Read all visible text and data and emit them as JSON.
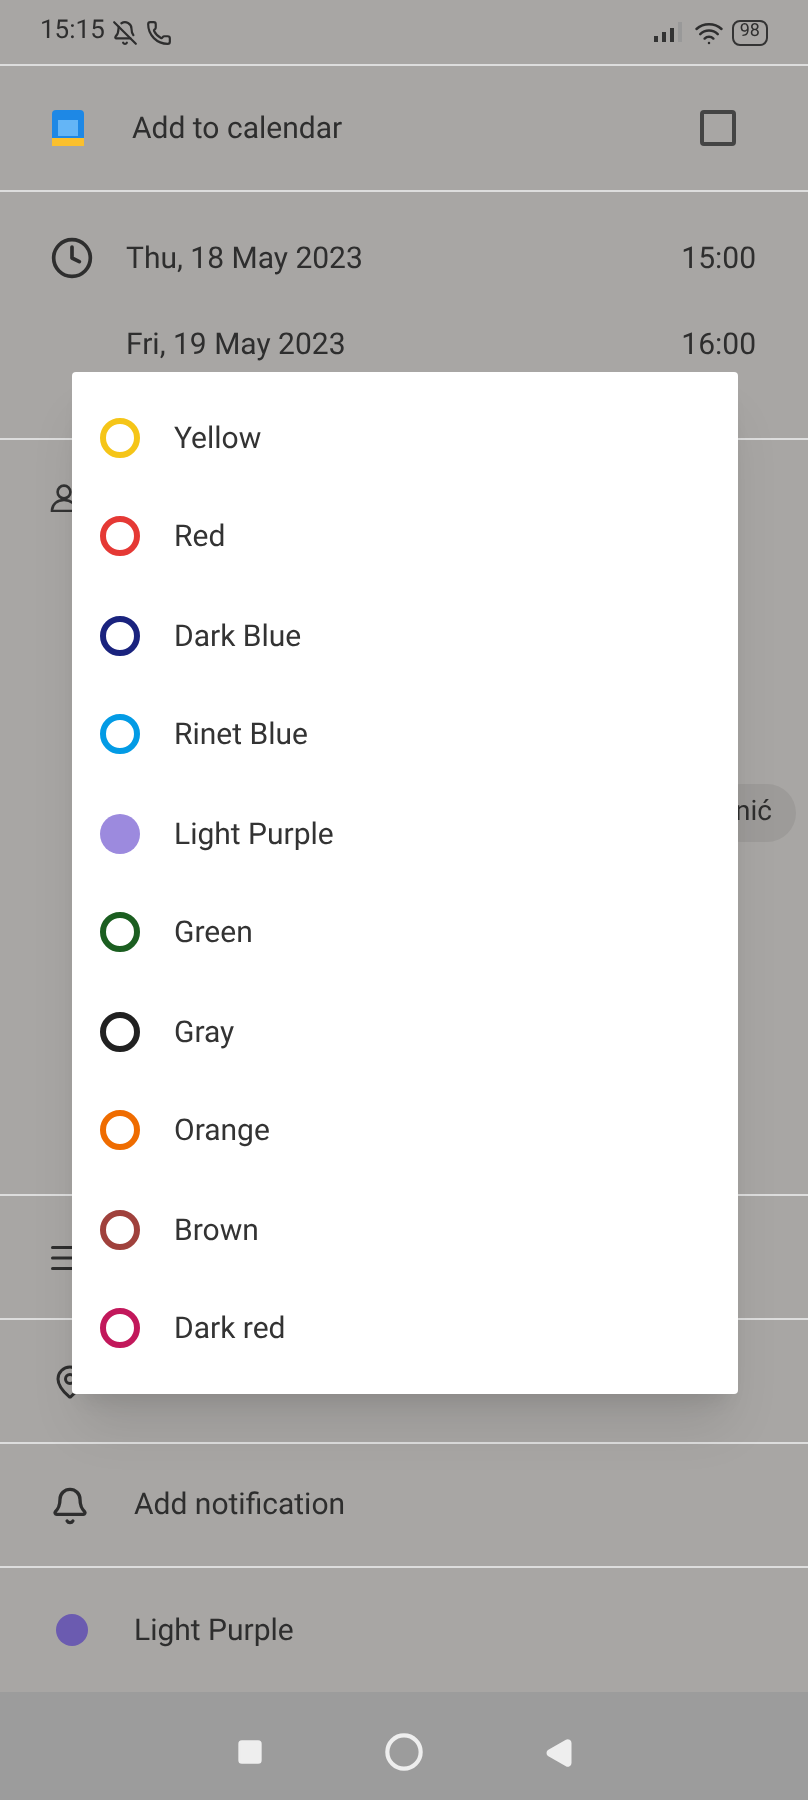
{
  "status_bar": {
    "time": "15:15",
    "battery": "98"
  },
  "calendar_row": {
    "label": "Add to calendar",
    "checked": false
  },
  "dates": [
    {
      "date": "Thu, 18 May 2023",
      "time": "15:00"
    },
    {
      "date": "Fri, 19 May 2023",
      "time": "16:00"
    }
  ],
  "attendee_chip": {
    "label": "nić"
  },
  "notification": {
    "label": "Add notification"
  },
  "color_row": {
    "label": "Light Purple",
    "color": "#6b5bb0"
  },
  "color_menu": [
    {
      "label": "Yellow",
      "color": "#f5c518",
      "selected": false
    },
    {
      "label": "Red",
      "color": "#e53935",
      "selected": false
    },
    {
      "label": "Dark Blue",
      "color": "#1a237e",
      "selected": false
    },
    {
      "label": "Rinet Blue",
      "color": "#039be5",
      "selected": false
    },
    {
      "label": "Light Purple",
      "color": "#9c8ade",
      "selected": true
    },
    {
      "label": "Green",
      "color": "#1b5e20",
      "selected": false
    },
    {
      "label": "Gray",
      "color": "#212121",
      "selected": false
    },
    {
      "label": "Orange",
      "color": "#ef6c00",
      "selected": false
    },
    {
      "label": "Brown",
      "color": "#a0413c",
      "selected": false
    },
    {
      "label": "Dark red",
      "color": "#c2185b",
      "selected": false
    }
  ]
}
